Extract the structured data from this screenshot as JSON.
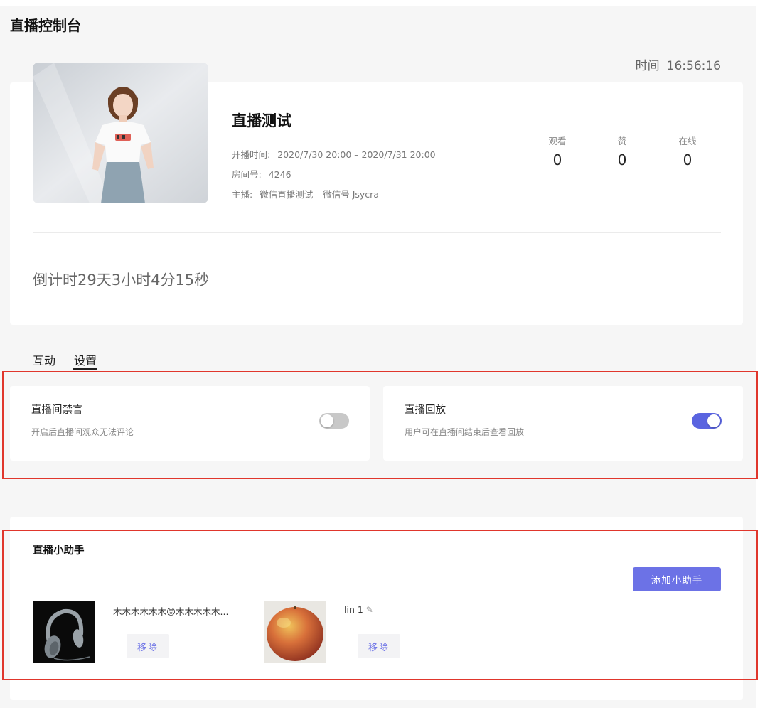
{
  "page": {
    "title": "直播控制台"
  },
  "clock": {
    "label": "时间",
    "value": "16:56:16"
  },
  "live": {
    "name": "直播测试",
    "time_label": "开播时间:",
    "time_value": "2020/7/30 20:00 – 2020/7/31 20:00",
    "room_label": "房间号:",
    "room_value": "4246",
    "host_label": "主播:",
    "host_value": "微信直播测试",
    "wechat_value": "微信号 Jsycra",
    "stats": [
      {
        "label": "观看",
        "value": "0"
      },
      {
        "label": "赞",
        "value": "0"
      },
      {
        "label": "在线",
        "value": "0"
      }
    ],
    "countdown": "倒计时29天3小时4分15秒"
  },
  "tabs": [
    {
      "label": "互动",
      "active": false
    },
    {
      "label": "设置",
      "active": true
    }
  ],
  "settings": [
    {
      "title": "直播间禁言",
      "desc": "开启后直播间观众无法评论",
      "enabled": false
    },
    {
      "title": "直播回放",
      "desc": "用户可在直播间结束后查看回放",
      "enabled": true
    }
  ],
  "assistant": {
    "title": "直播小助手",
    "add_label": "添加小助手",
    "helpers": [
      {
        "name": "木木木木木木😡木木木木木...",
        "avatar": "headphones-image",
        "remove_label": "移除"
      },
      {
        "name": "lin 1",
        "avatar": "mango-image",
        "remove_label": "移除"
      }
    ]
  },
  "colors": {
    "accent": "#5a64e0",
    "highlight_border": "#e0362c",
    "background": "#f6f6f6"
  }
}
